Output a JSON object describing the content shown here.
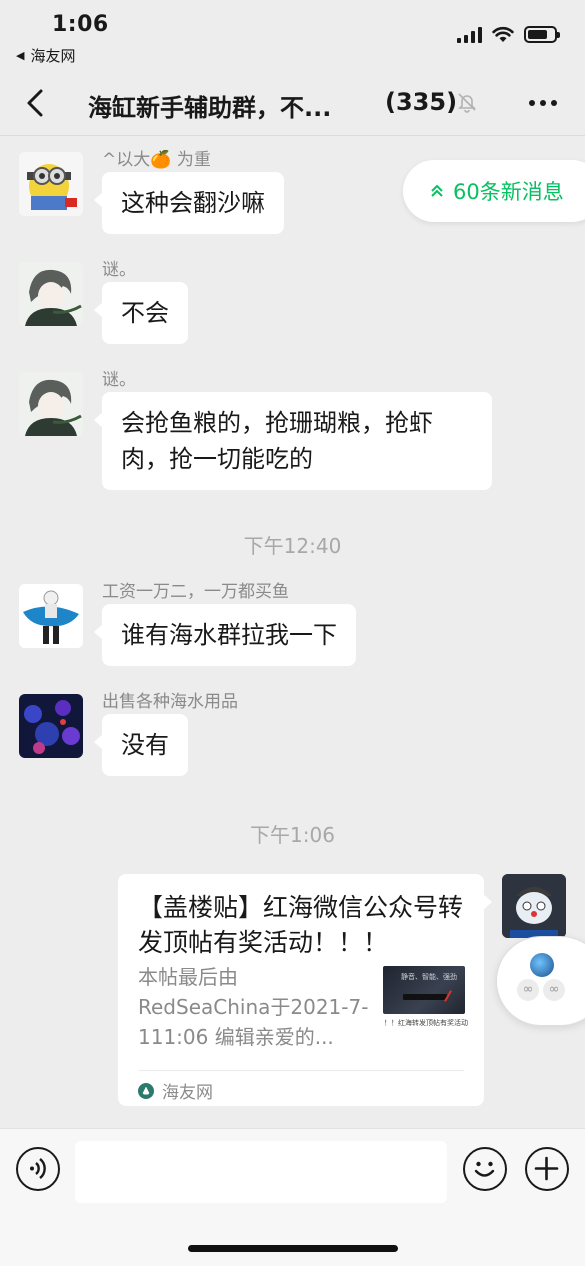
{
  "status_bar": {
    "time": "1:06",
    "back_app_label": "海友网",
    "battery_percent": 80,
    "icons": [
      "signal-icon",
      "wifi-icon",
      "battery-icon"
    ]
  },
  "nav": {
    "title": "海缸新手辅助群，不...",
    "member_count": "(335)",
    "icons": [
      "back-arrow-icon",
      "mute-bell-icon",
      "more-dots-icon"
    ]
  },
  "new_messages_pill": {
    "label": "60条新消息",
    "icon": "double-chevron-up-icon",
    "color": "#07c160"
  },
  "messages": [
    {
      "sender": "^以大🍊 为重",
      "text": "这种会翻沙嘛"
    },
    {
      "sender": "谜。",
      "text": "不会"
    },
    {
      "sender": "谜。",
      "text": "会抢鱼粮的，抢珊瑚粮，抢虾肉，抢一切能吃的"
    },
    {
      "sender": "工资一万二，一万都买鱼",
      "text": "谁有海水群拉我一下"
    },
    {
      "sender": "出售各种海水用品",
      "text": "没有"
    }
  ],
  "timestamps": [
    "下午12:40",
    "下午1:06"
  ],
  "link_card": {
    "title": "【盖楼贴】红海微信公众号转发顶帖有奖活动！！！",
    "description": "本帖最后由RedSeaChina于2021-7-111:06 编辑亲爱的...",
    "thumb_text": "静音、智能、强劲",
    "thumb_caption": "！！红海转发顶帖有奖活动",
    "source": "海友网"
  },
  "input_bar": {
    "placeholder": "",
    "icons": [
      "voice-icon",
      "emoji-icon",
      "plus-icon"
    ]
  },
  "colors": {
    "background": "#ededed",
    "bubble": "#ffffff",
    "accent_green": "#07c160"
  }
}
